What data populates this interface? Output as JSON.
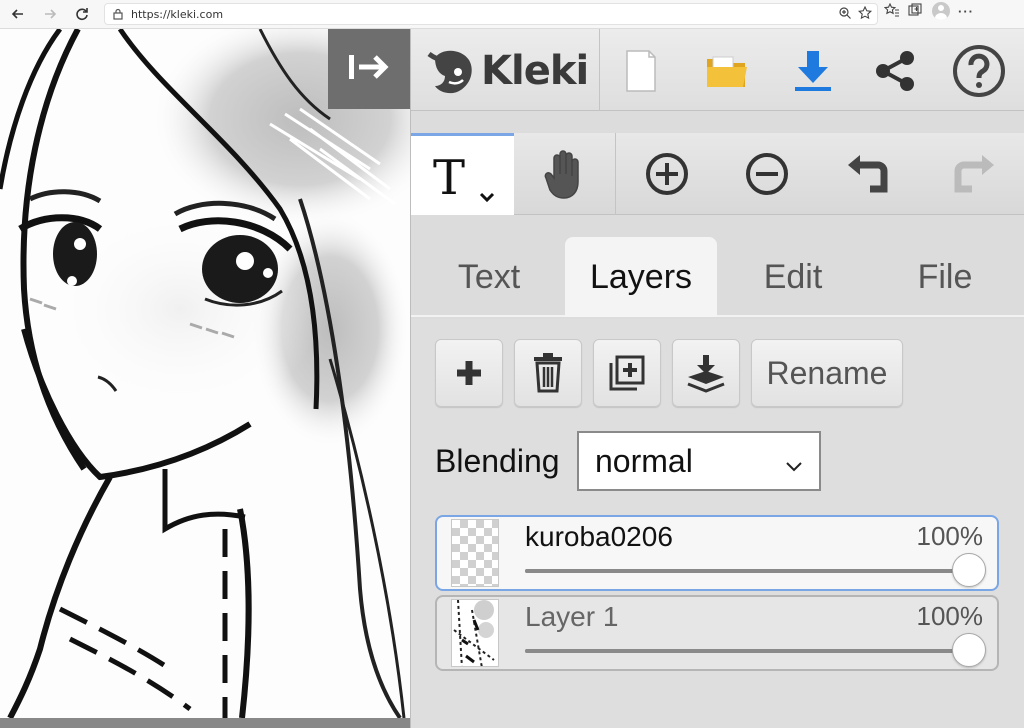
{
  "browser": {
    "url": "https://kleki.com"
  },
  "app": {
    "name": "Kleki"
  },
  "top_bar": {
    "icons": [
      "new-image-icon",
      "open-folder-icon",
      "download-icon",
      "share-icon",
      "help-icon"
    ]
  },
  "tools": {
    "active": "text",
    "items": [
      "text-tool-icon",
      "hand-tool-icon",
      "zoom-in-icon",
      "zoom-out-icon",
      "undo-icon",
      "redo-icon"
    ]
  },
  "tabs": [
    {
      "label": "Text"
    },
    {
      "label": "Layers"
    },
    {
      "label": "Edit"
    },
    {
      "label": "File"
    }
  ],
  "active_tab": "Layers",
  "layers_panel": {
    "rename_label": "Rename",
    "blending_label": "Blending",
    "blending_value": "normal",
    "layers": [
      {
        "name": "kuroba0206",
        "opacity_label": "100%",
        "opacity": 1.0,
        "selected": true
      },
      {
        "name": "Layer 1",
        "opacity_label": "100%",
        "opacity": 1.0,
        "selected": false
      }
    ]
  },
  "colors": {
    "accent": "#7aa6e6",
    "download_blue": "#1f7ae0",
    "folder_yellow": "#f3c13a"
  }
}
